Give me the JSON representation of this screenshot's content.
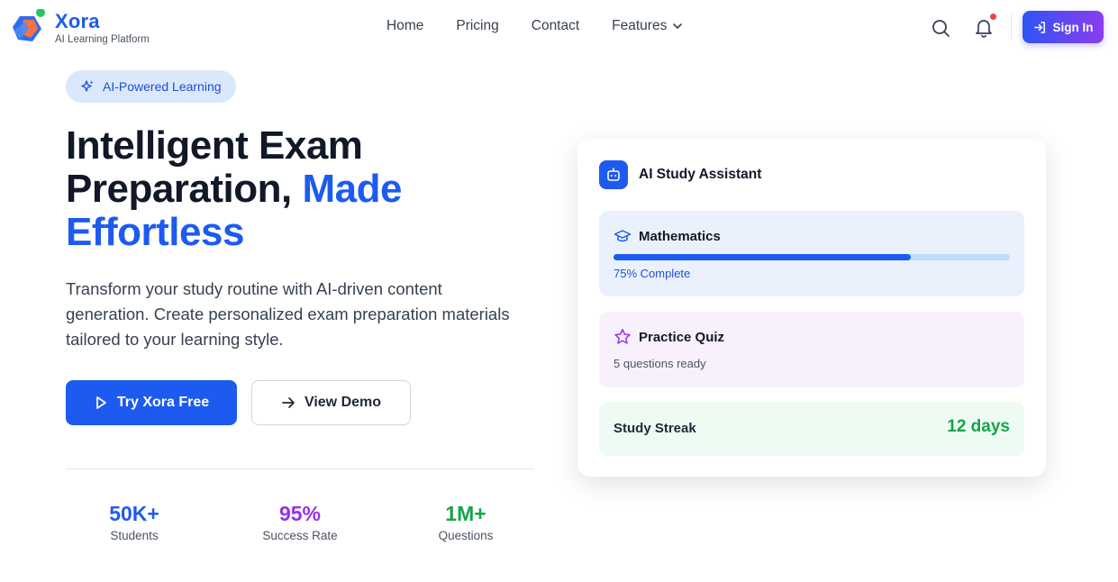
{
  "header": {
    "brand_name": "Xora",
    "brand_sub": "AI Learning Platform",
    "nav": [
      "Home",
      "Pricing",
      "Contact",
      "Features"
    ],
    "signin_label": "Sign In"
  },
  "hero": {
    "badge": "AI-Powered Learning",
    "title_line1": "Intelligent Exam",
    "title_line2": "Preparation, ",
    "title_accent1": "Made",
    "title_accent2": "Effortless",
    "description": "Transform your study routine with AI-driven content generation. Create personalized exam preparation materials tailored to your learning style.",
    "primary_button": "Try Xora Free",
    "secondary_button": "View Demo"
  },
  "stats": [
    {
      "value": "50K+",
      "label": "Students",
      "color": "#1d5bf0"
    },
    {
      "value": "95%",
      "label": "Success Rate",
      "color": "#9333ea"
    },
    {
      "value": "1M+",
      "label": "Questions",
      "color": "#16a34a"
    }
  ],
  "assistant": {
    "title": "AI Study Assistant",
    "math_title": "Mathematics",
    "math_progress": 0.75,
    "math_sub": "75% Complete",
    "quiz_title": "Practice Quiz",
    "quiz_sub": "5 questions ready",
    "streak_label": "Study Streak",
    "streak_value": "12 days"
  },
  "colors": {
    "brand": "#1d5bf0",
    "accent_purple": "#8b3cf0",
    "success": "#16a34a",
    "alert": "#ef4444"
  },
  "icons": {
    "logo": "xora-logo-icon",
    "search": "search-icon",
    "notifications": "bell-icon",
    "signin": "login-icon",
    "features_dropdown": "chevron-down-icon",
    "badge": "sparkles-icon",
    "primary_button": "play-icon",
    "secondary_button": "arrow-right-icon",
    "assistant": "robot-icon",
    "math": "graduation-cap-icon",
    "quiz": "star-icon"
  }
}
